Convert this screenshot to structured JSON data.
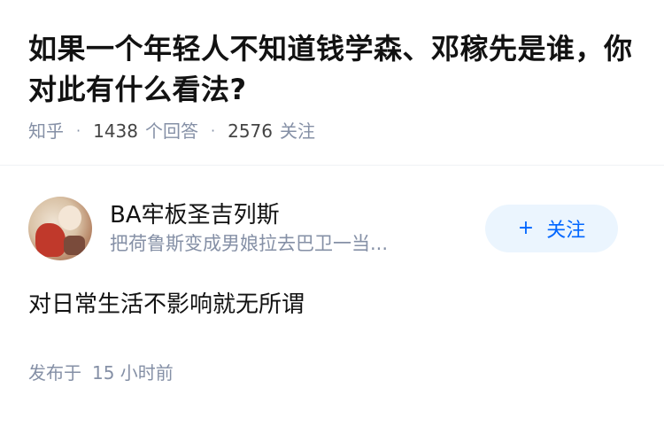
{
  "question": {
    "title": "如果一个年轻人不知道钱学森、邓稼先是谁，你对此有什么看法?",
    "source": "知乎",
    "separator": "·",
    "answer_count": "1438",
    "answer_label": "个回答",
    "follower_count": "2576",
    "follower_label": "关注"
  },
  "answer": {
    "author_name": "BA牢板圣吉列斯",
    "author_bio": "把荷鲁斯变成男娘拉去巴卫一当...",
    "follow_button_label": "关注",
    "follow_icon": "plus-icon",
    "content": "对日常生活不影响就无所谓",
    "publish_label": "发布于",
    "publish_time": "15 小时前"
  },
  "colors": {
    "accent": "#0066ff",
    "follow_bg": "#ebf5fe",
    "meta_gray": "#8590a6",
    "text": "#121212"
  }
}
